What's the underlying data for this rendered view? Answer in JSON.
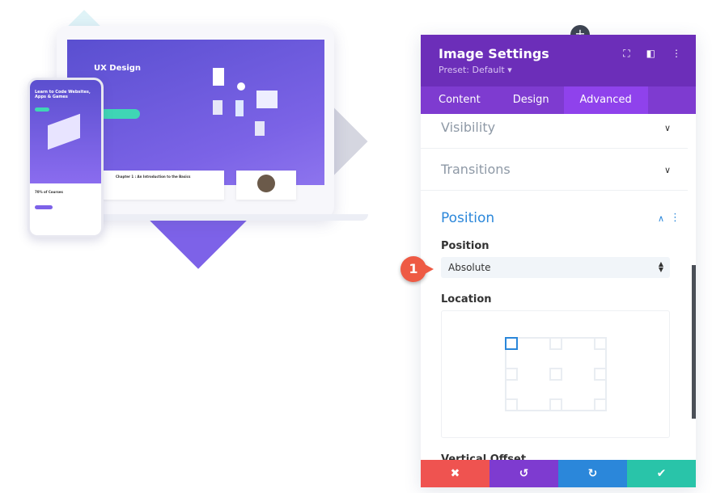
{
  "illustration": {
    "laptop_title": "UX Design",
    "laptop_chapter": "Chapter 1 : An Introduction to the Basics",
    "phone_title": "Learn to Code Websites, Apps & Games",
    "phone_courses": "70% of Courses"
  },
  "panel": {
    "title": "Image Settings",
    "preset": "Preset: Default ▾",
    "icons": [
      "focus-icon",
      "sidebar-layout-icon",
      "more-vertical-icon"
    ],
    "tabs": [
      {
        "label": "Content"
      },
      {
        "label": "Design"
      },
      {
        "label": "Advanced",
        "active": true
      }
    ],
    "sections": {
      "visibility": "Visibility",
      "transitions": "Transitions",
      "position": "Position"
    },
    "position_label": "Position",
    "position_value": "Absolute",
    "location_label": "Location",
    "location_selected": "top-left",
    "vertical_offset_label": "Vertical Offset",
    "footer": [
      "close-icon",
      "undo-icon",
      "redo-icon",
      "check-icon"
    ]
  },
  "badge": "1",
  "colors": {
    "header": "#6c2eb9",
    "tabs": "#7e3bd0",
    "tab_active": "#8f42ec",
    "accent": "#2b87da",
    "cancel": "#ef5350",
    "undo": "#7e3bd0",
    "redo": "#2b87da",
    "save": "#29c4a9",
    "badge": "#ee5a44"
  }
}
